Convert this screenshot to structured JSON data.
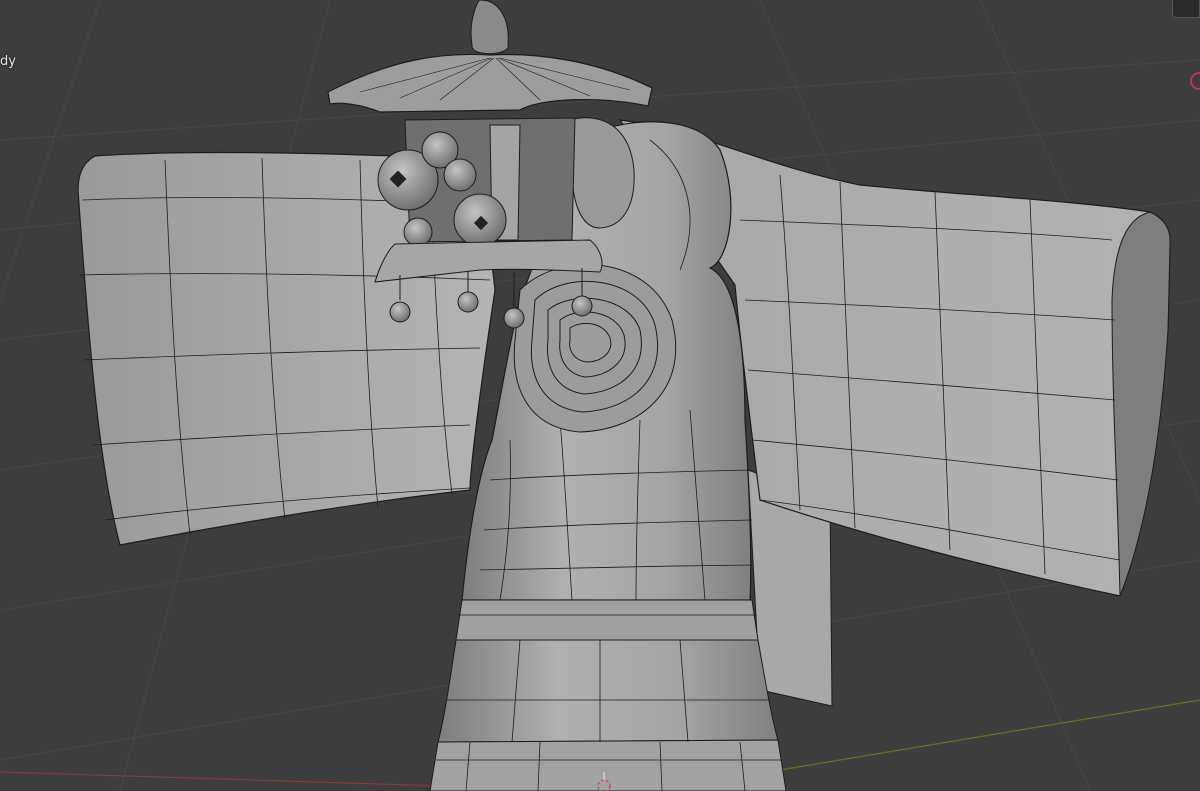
{
  "viewport": {
    "header_text": "dy",
    "background_color": "#3d3d3d",
    "mesh_color": "#a3a3a3",
    "wire_color": "#1c1c1c",
    "grid_color": "#474747",
    "x_axis_color": "#8a3a3a",
    "y_axis_color": "#5a7a2a"
  },
  "icons": {
    "nav_button": "navigation-gizmo-icon",
    "axis": "x-axis-gizmo-icon",
    "origin": "3d-cursor-icon"
  }
}
